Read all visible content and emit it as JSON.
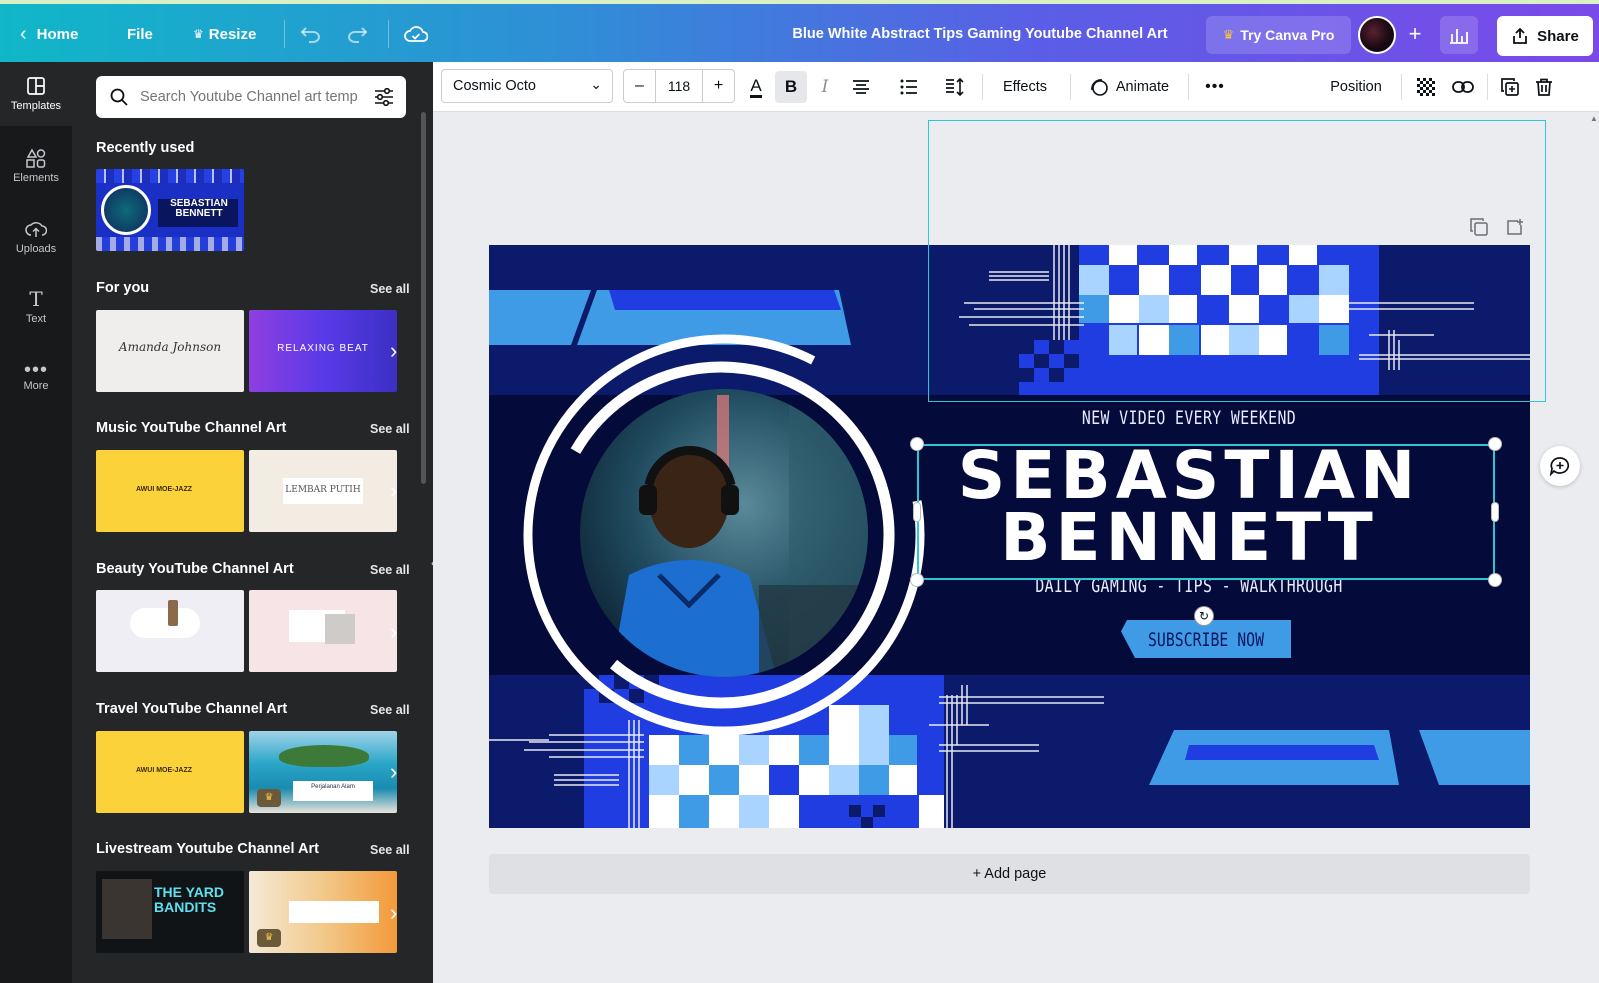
{
  "topbar": {
    "home": "Home",
    "file": "File",
    "resize": "Resize",
    "doc_title": "Blue White Abstract Tips Gaming Youtube Channel Art",
    "try_pro": "Try Canva Pro",
    "share": "Share"
  },
  "rail": {
    "items": [
      {
        "label": "Templates",
        "icon": "templates-icon"
      },
      {
        "label": "Elements",
        "icon": "elements-icon"
      },
      {
        "label": "Uploads",
        "icon": "uploads-icon"
      },
      {
        "label": "Text",
        "icon": "text-icon"
      },
      {
        "label": "More",
        "icon": "more-icon"
      }
    ]
  },
  "panel": {
    "search_placeholder": "Search Youtube Channel art temp",
    "recently_used": "Recently used",
    "recent_thumb_text": "SEBASTIAN BENNETT",
    "see_all": "See all",
    "sections": [
      {
        "title": "For you",
        "thumbs": [
          "Amanda Johnson",
          "RELAXING BEAT"
        ]
      },
      {
        "title": "Music YouTube Channel Art",
        "thumbs": [
          "AWUI MOE-JAZZ",
          "LEMBAR PUTIH"
        ]
      },
      {
        "title": "Beauty YouTube Channel Art",
        "thumbs": [
          "",
          ""
        ]
      },
      {
        "title": "Travel YouTube Channel Art",
        "thumbs": [
          "AWUI MOE-JAZZ",
          "Perjalanan Alam"
        ]
      },
      {
        "title": "Livestream Youtube Channel Art",
        "thumbs": [
          "THE YARD BANDITS",
          ""
        ]
      }
    ]
  },
  "toolbar": {
    "font": "Cosmic Octo",
    "size": "118",
    "effects": "Effects",
    "animate": "Animate",
    "position": "Position"
  },
  "design": {
    "tagline_top": "NEW VIDEO EVERY WEEKEND",
    "name_line1": "SEBASTIAN",
    "name_line2": "BENNETT",
    "tagline_bottom": "DAILY GAMING - TIPS - WALKTHROUGH",
    "cta": "SUBSCRIBE NOW"
  },
  "canvas": {
    "add_page": "+ Add page"
  },
  "colors": {
    "design_navy": "#0b1a6b",
    "design_dark": "#040a3a",
    "design_blue": "#1f3de0",
    "design_sky": "#3f9be6",
    "selection": "#2fc6d4"
  }
}
